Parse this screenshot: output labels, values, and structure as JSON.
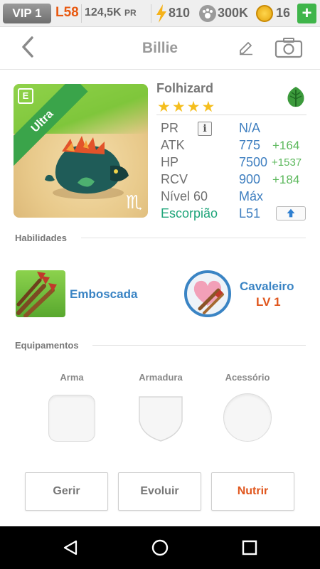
{
  "topbar": {
    "vip": "VIP 1",
    "level": "L58",
    "power": "124,5K",
    "power_unit": "PR",
    "energy": "810",
    "food": "300K",
    "coins": "16",
    "add": "+"
  },
  "header": {
    "title": "Billie"
  },
  "monster": {
    "species": "Folhizard",
    "rarity": "Ultra",
    "stars": [
      "★",
      "★",
      "★",
      "★"
    ],
    "element": "leaf-icon",
    "zodiac_glyph": "♏"
  },
  "stats": {
    "pr_label": "PR",
    "pr_value": "N/A",
    "atk_label": "ATK",
    "atk_value": "775",
    "atk_bonus": "+164",
    "hp_label": "HP",
    "hp_value": "7500",
    "hp_bonus": "+1537",
    "rcv_label": "RCV",
    "rcv_value": "900",
    "rcv_bonus": "+184",
    "level_label": "Nível 60",
    "level_value": "Máx",
    "sign_label": "Escorpião",
    "sign_value": "L51"
  },
  "skills": {
    "section_title": "Habilidades",
    "active_name": "Emboscada",
    "leader_name": "Cavaleiro",
    "leader_level": "LV 1"
  },
  "equipment": {
    "section_title": "Equipamentos",
    "weapon": "Arma",
    "armor": "Armadura",
    "accessory": "Acessório"
  },
  "actions": {
    "manage": "Gerir",
    "evolve": "Evoluir",
    "feed": "Nutrir"
  },
  "colors": {
    "accent_blue": "#3a84c4",
    "bonus_green": "#5cb85c",
    "orange": "#e0561d",
    "ultra_green": "#3aa44a",
    "star_gold": "#f5be1d"
  }
}
